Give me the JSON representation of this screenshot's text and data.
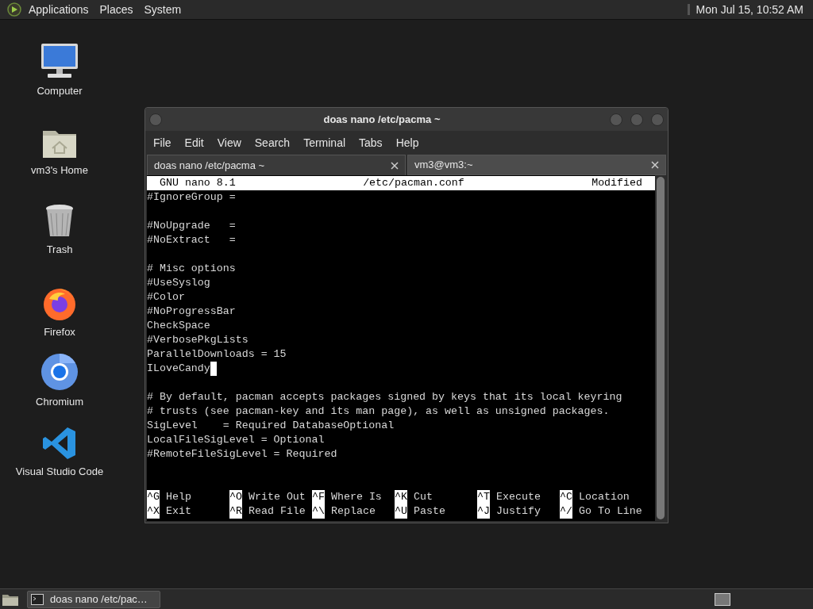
{
  "top_panel": {
    "menus": [
      "Applications",
      "Places",
      "System"
    ],
    "clock": "Mon Jul 15, 10:52 AM"
  },
  "desktop_icons": [
    {
      "label": "Computer",
      "kind": "computer"
    },
    {
      "label": "vm3's Home",
      "kind": "home"
    },
    {
      "label": "Trash",
      "kind": "trash"
    },
    {
      "label": "Firefox",
      "kind": "firefox"
    },
    {
      "label": "Chromium",
      "kind": "chromium"
    },
    {
      "label": "Visual Studio Code",
      "kind": "vscode"
    }
  ],
  "window": {
    "title": "doas nano /etc/pacma ~",
    "menu": [
      "File",
      "Edit",
      "View",
      "Search",
      "Terminal",
      "Tabs",
      "Help"
    ],
    "tabs": [
      {
        "label": "doas nano /etc/pacma ~",
        "selected": true
      },
      {
        "label": "vm3@vm3:~",
        "selected": false
      }
    ],
    "nano": {
      "header": {
        "version": "GNU nano 8.1",
        "file": "/etc/pacman.conf",
        "status": "Modified"
      },
      "blocks": [
        [
          {
            "text": "#IgnoreGroup =",
            "cursor": false
          }
        ],
        [
          {
            "text": "#NoUpgrade   =",
            "cursor": false
          },
          {
            "text": "#NoExtract   =",
            "cursor": false
          }
        ],
        [
          {
            "text": "# Misc options",
            "cursor": false
          },
          {
            "text": "#UseSyslog",
            "cursor": false
          },
          {
            "text": "#Color",
            "cursor": false
          },
          {
            "text": "#NoProgressBar",
            "cursor": false
          },
          {
            "text": "CheckSpace",
            "cursor": false
          },
          {
            "text": "#VerbosePkgLists",
            "cursor": false
          },
          {
            "text": "ParallelDownloads = 15",
            "cursor": false
          },
          {
            "text": "ILoveCandy",
            "cursor": true
          }
        ],
        [
          {
            "text": "# By default, pacman accepts packages signed by keys that its local keyring",
            "cursor": false
          },
          {
            "text": "# trusts (see pacman-key and its man page), as well as unsigned packages.",
            "cursor": false
          },
          {
            "text": "SigLevel    = Required DatabaseOptional",
            "cursor": false
          },
          {
            "text": "LocalFileSigLevel = Optional",
            "cursor": false
          },
          {
            "text": "#RemoteFileSigLevel = Required",
            "cursor": false
          }
        ]
      ],
      "shortcuts": [
        [
          {
            "key": "^G",
            "label": "Help"
          },
          {
            "key": "^O",
            "label": "Write Out"
          },
          {
            "key": "^F",
            "label": "Where Is"
          },
          {
            "key": "^K",
            "label": "Cut"
          },
          {
            "key": "^T",
            "label": "Execute"
          },
          {
            "key": "^C",
            "label": "Location"
          }
        ],
        [
          {
            "key": "^X",
            "label": "Exit"
          },
          {
            "key": "^R",
            "label": "Read File"
          },
          {
            "key": "^\\",
            "label": "Replace"
          },
          {
            "key": "^U",
            "label": "Paste"
          },
          {
            "key": "^J",
            "label": "Justify"
          },
          {
            "key": "^/",
            "label": "Go To Line"
          }
        ]
      ]
    }
  },
  "taskbar": {
    "tasks": [
      "doas nano /etc/pac…"
    ]
  }
}
